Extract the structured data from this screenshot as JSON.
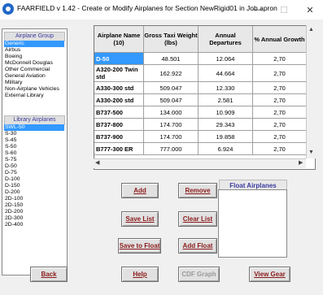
{
  "window": {
    "title": "FAARFIELD v 1.42 - Create or Modify Airplanes for Section NewRigid01 in Job apron",
    "minimize": "—",
    "maximize": "☐",
    "close": "✕"
  },
  "airplane_group": {
    "header": "Airplane Group",
    "items": [
      "Generic",
      "Airbus",
      "Boeing",
      "McDonnell Douglas",
      "Other Commercial",
      "General Aviation",
      "Military",
      "Non-Airplane Vehicles",
      "External Library"
    ],
    "selected": "Generic"
  },
  "library": {
    "header": "Library Airplanes",
    "items": [
      "SWL-50",
      "S-30",
      "S-45",
      "S-50",
      "S-60",
      "S-75",
      "D-50",
      "D-75",
      "D-100",
      "D-150",
      "D-200",
      "2D-100",
      "2D-150",
      "2D-200",
      "2D-300",
      "2D-400"
    ],
    "selected": "SWL-50"
  },
  "table": {
    "headers": [
      "Airplane Name (10)",
      "Gross Taxi Weight (lbs)",
      "Annual Departures",
      "% Annual Growth"
    ],
    "rows": [
      {
        "name": "D-50",
        "weight": "48.501",
        "departures": "12.064",
        "growth": "2,70"
      },
      {
        "name": "A320-200 Twin std",
        "weight": "162.922",
        "departures": "44.664",
        "growth": "2,70"
      },
      {
        "name": "A330-300 std",
        "weight": "509.047",
        "departures": "12.330",
        "growth": "2,70"
      },
      {
        "name": "A330-200 std",
        "weight": "509.047",
        "departures": "2.581",
        "growth": "2,70"
      },
      {
        "name": "B737-500",
        "weight": "134.000",
        "departures": "10.909",
        "growth": "2,70"
      },
      {
        "name": "B737-800",
        "weight": "174.700",
        "departures": "29.343",
        "growth": "2,70"
      },
      {
        "name": "B737-900",
        "weight": "174.700",
        "departures": "19.858",
        "growth": "2,70"
      },
      {
        "name": "B777-300 ER",
        "weight": "777.000",
        "departures": "6.924",
        "growth": "2,70"
      }
    ],
    "selected_row": 0
  },
  "buttons": {
    "add": "Add",
    "remove": "Remove",
    "save_list": "Save List",
    "clear_list": "Clear List",
    "save_to_float": "Save to Float",
    "add_float": "Add Float",
    "back": "Back",
    "help": "Help",
    "cdf_graph": "CDF Graph",
    "view_gear": "View Gear"
  },
  "float_airplanes": {
    "header": "Float Airplanes"
  },
  "colors": {
    "selection": "#3399ff",
    "button_text": "#8b1a1a",
    "header_text": "#3a3aa0"
  }
}
